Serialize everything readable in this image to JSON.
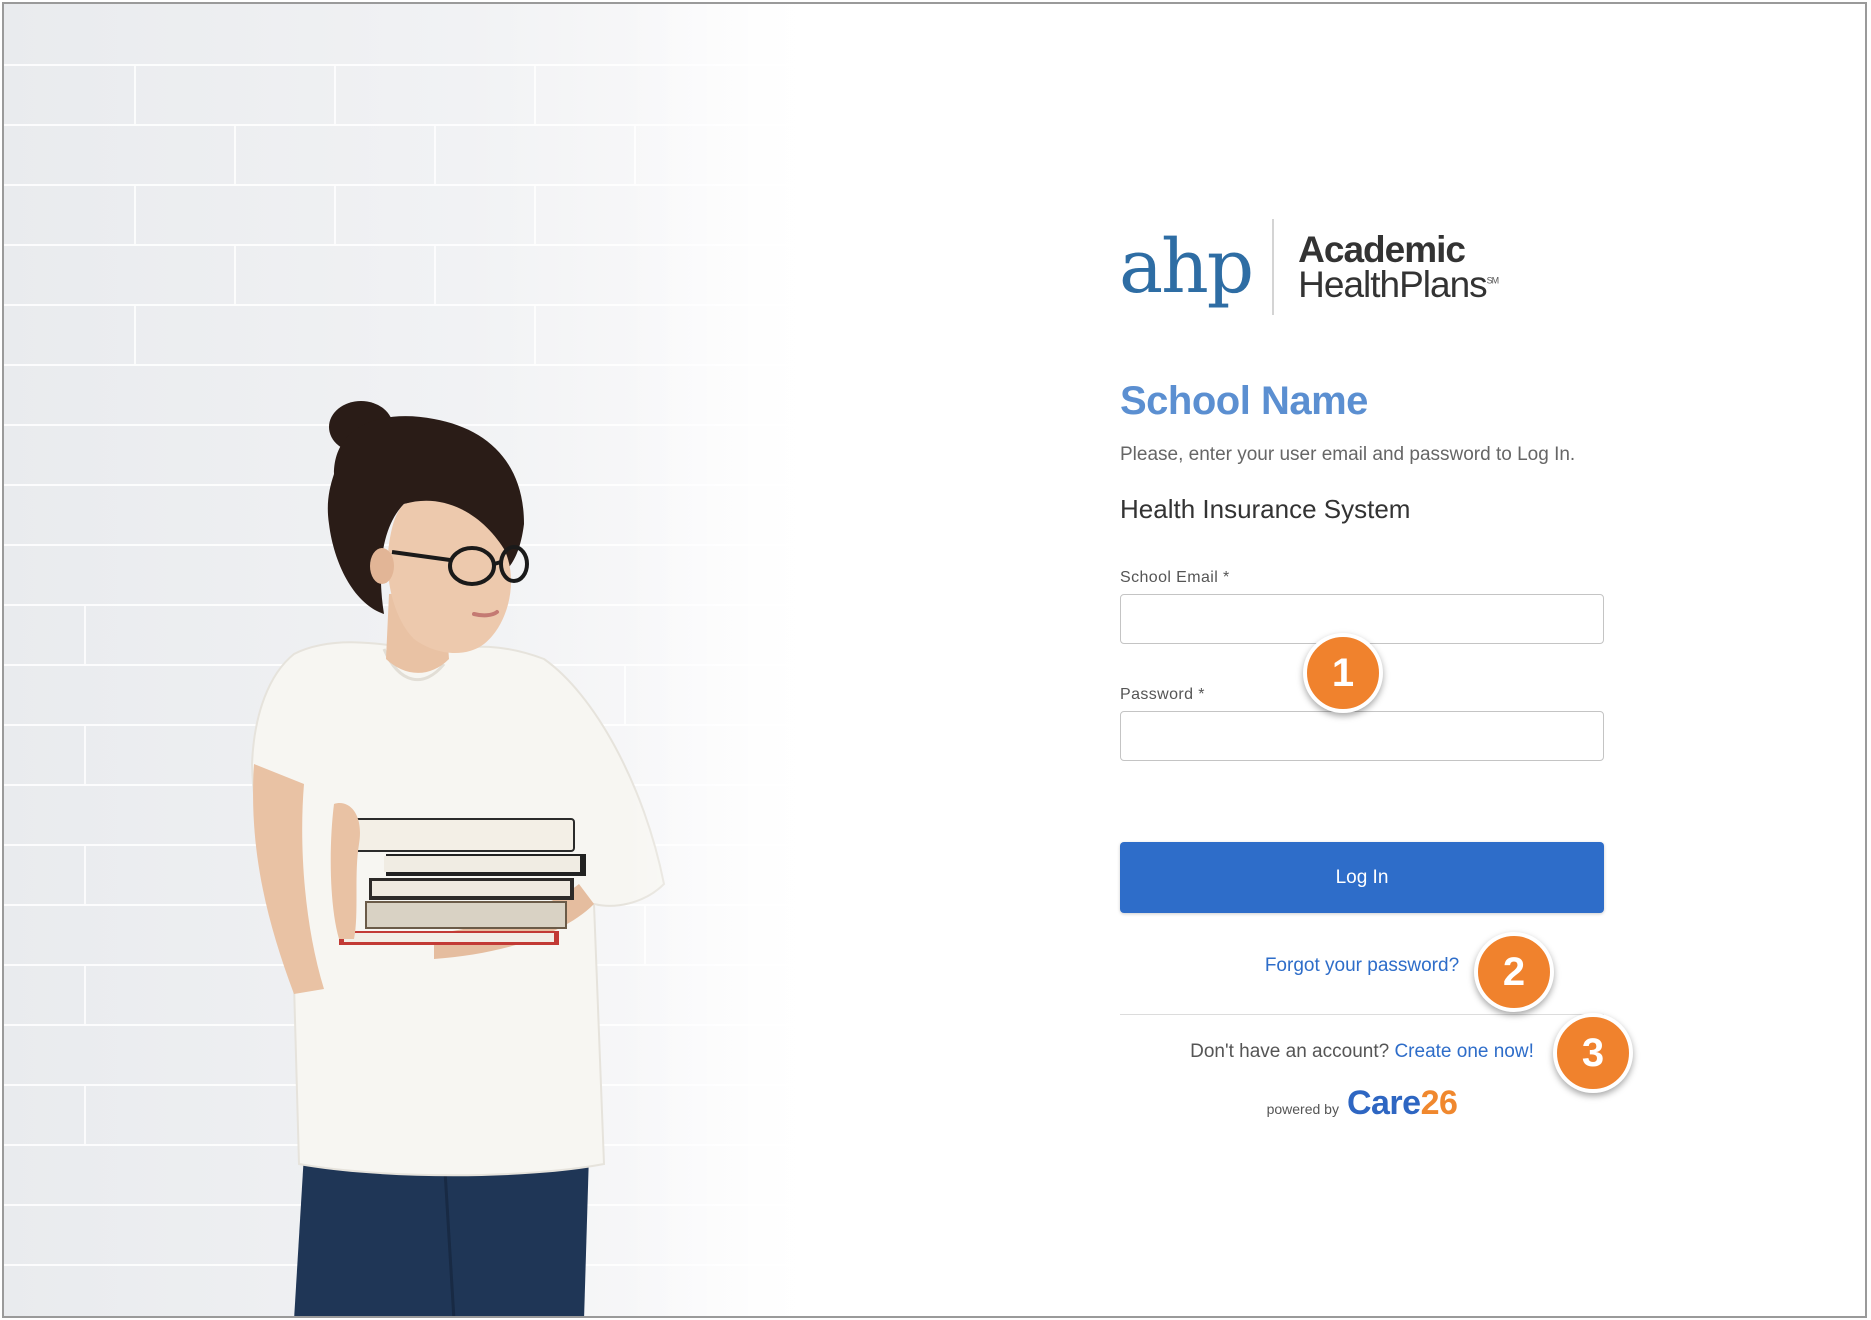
{
  "logo": {
    "mark": "ahp",
    "line1": "Academic",
    "line2": "HealthPlans",
    "trademark": "SM"
  },
  "header": {
    "school_name": "School Name",
    "instructions": "Please, enter your user email and password to Log In.",
    "system_title": "Health Insurance System"
  },
  "form": {
    "email_label": "School Email *",
    "email_value": "",
    "password_label": "Password *",
    "password_value": "",
    "login_button": "Log In",
    "forgot_link": "Forgot your password?",
    "no_account_text": "Don't have an account?",
    "create_link": "Create one now!"
  },
  "footer": {
    "powered_by": "powered by",
    "brand_word": "Care",
    "brand_number": "26"
  },
  "callouts": [
    "1",
    "2",
    "3"
  ],
  "colors": {
    "accent": "#2e6dc9",
    "school_name": "#5b8fd1",
    "callout": "#f0822d",
    "brand_orange": "#f0882e"
  },
  "icons": [
    "student-photo"
  ]
}
